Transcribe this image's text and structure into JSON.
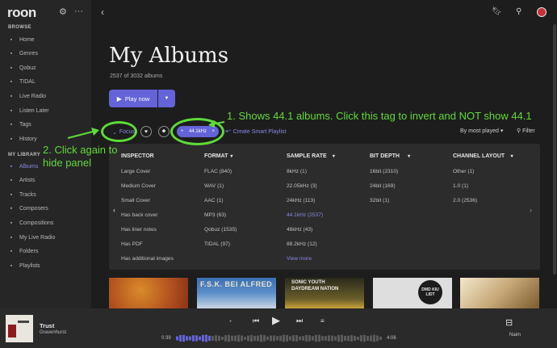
{
  "app": {
    "logo": "roon"
  },
  "sidebar": {
    "browse_title": "BROWSE",
    "browse_items": [
      {
        "label": "Home",
        "icon": "home-icon"
      },
      {
        "label": "Genres",
        "icon": "genres-icon"
      },
      {
        "label": "Qobuz",
        "icon": "qobuz-icon"
      },
      {
        "label": "TIDAL",
        "icon": "tidal-icon"
      },
      {
        "label": "Live Radio",
        "icon": "radio-icon"
      },
      {
        "label": "Listen Later",
        "icon": "clock-icon"
      },
      {
        "label": "Tags",
        "icon": "tag-icon"
      },
      {
        "label": "History",
        "icon": "history-icon"
      }
    ],
    "library_title": "MY LIBRARY",
    "library_items": [
      {
        "label": "Albums",
        "icon": "album-icon",
        "active": true
      },
      {
        "label": "Artists",
        "icon": "artist-icon"
      },
      {
        "label": "Tracks",
        "icon": "track-icon"
      },
      {
        "label": "Composers",
        "icon": "composer-icon"
      },
      {
        "label": "Compositions",
        "icon": "composition-icon"
      },
      {
        "label": "My Live Radio",
        "icon": "radio-icon"
      },
      {
        "label": "Folders",
        "icon": "folder-icon"
      },
      {
        "label": "Playlists",
        "icon": "playlist-icon"
      }
    ]
  },
  "main": {
    "title": "My Albums",
    "count": "2537 of 3032 albums",
    "play_label": "Play now",
    "focus_label": "Focus",
    "tag_label": "44.1kHz",
    "smart_playlist": "Create Smart Playlist",
    "sort_label": "By most played",
    "filter_label": "Filter"
  },
  "annotations": {
    "note1": "1. Shows 44.1 albums. Click this tag to invert and NOT show 44.1",
    "note2_line1": "2. Click again to",
    "note2_line2": "hide panel"
  },
  "focus_panel": {
    "columns": [
      {
        "header": "INSPECTOR",
        "items": [
          "Large Cover",
          "Medium Cover",
          "Small Cover",
          "Has back cover",
          "Has liner notes",
          "Has PDF",
          "Has additional images"
        ]
      },
      {
        "header": "FORMAT",
        "items": [
          "FLAC (840)",
          "WAV (1)",
          "AAC (1)",
          "MP3 (63)",
          "Qobuz (1535)",
          "TIDAL (97)"
        ]
      },
      {
        "header": "SAMPLE RATE",
        "items": [
          "8kHz (1)",
          "22.05kHz (3)",
          "24kHz (113)",
          "44.1kHz (2537)",
          "48kHz (43)",
          "88.2kHz (12)"
        ],
        "selected": "44.1kHz (2537)",
        "more": "View more"
      },
      {
        "header": "BIT DEPTH",
        "items": [
          "16bit (2310)",
          "24bit (169)",
          "32bit (1)"
        ]
      },
      {
        "header": "CHANNEL LAYOUT",
        "items": [
          "Other (1)",
          "1.0 (1)",
          "2.0 (2536)"
        ]
      }
    ]
  },
  "albums": [
    {
      "text": ""
    },
    {
      "text": "F.S.K. BEI ALFRED"
    },
    {
      "text": "SONIC YOUTH",
      "sub": "DAYDREAM NATION"
    },
    {
      "text": "DMD KIU LIDT"
    },
    {
      "text": ""
    }
  ],
  "player": {
    "track": "Trust",
    "artist": "Gravenhurst",
    "elapsed": "0:39",
    "duration": "4:06",
    "progress_fraction": 0.16,
    "zone": "Naim"
  },
  "colors": {
    "accent": "#6463d8",
    "accent_text": "#8a89e8",
    "annotation": "#5fda3a"
  }
}
